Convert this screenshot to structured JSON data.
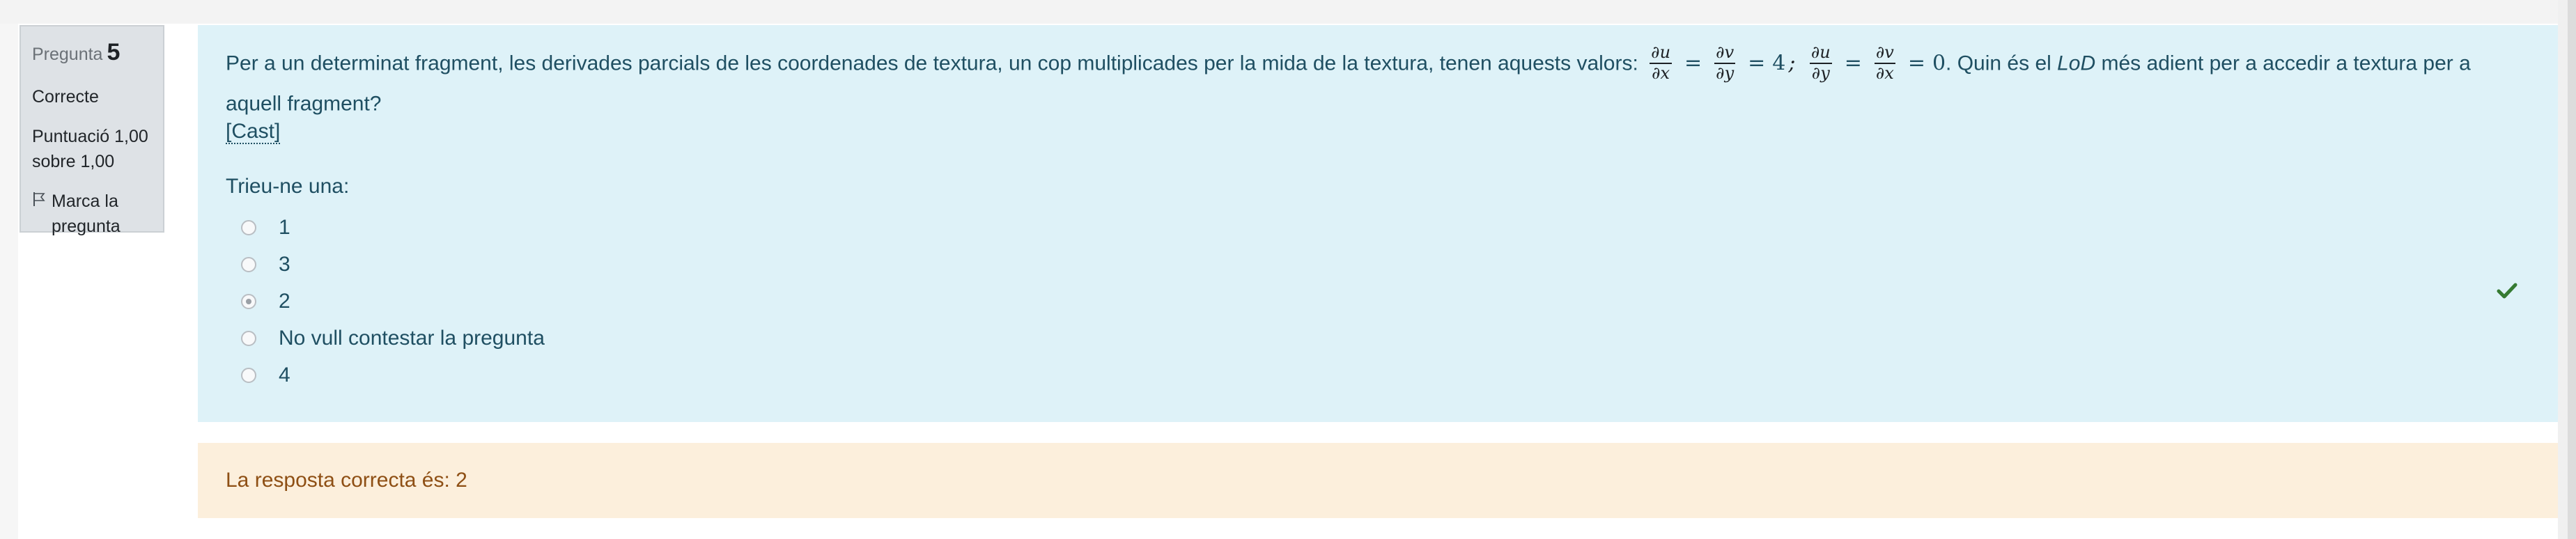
{
  "question_info": {
    "label": "Pregunta",
    "number": "5",
    "state": "Correcte",
    "grade": "Puntuació 1,00 sobre 1,00",
    "flag": "Marca la pregunta"
  },
  "question": {
    "text_before": "Per a un determinat fragment, les derivades parcials de les coordenades de textura, un cop multiplicades per la mida de la textura, tenen aquests valors:",
    "math": {
      "du": "∂u",
      "dv": "∂v",
      "dx": "∂x",
      "dy": "∂y",
      "eq": "=",
      "four": "4",
      "zero": "0",
      "sep": ";"
    },
    "text_mid": ". Quin és el ",
    "lod": "LoD",
    "text_after": " més adient per a accedir a textura per a aquell fragment?",
    "cast_link": "[Cast]"
  },
  "prompt": "Trieu-ne una:",
  "answers": [
    {
      "label": "1",
      "selected": false
    },
    {
      "label": "3",
      "selected": false
    },
    {
      "label": "2",
      "selected": true
    },
    {
      "label": "No vull contestar la pregunta",
      "selected": false
    },
    {
      "label": "4",
      "selected": false
    }
  ],
  "feedback": {
    "right_answer": "La resposta correcta és: 2"
  },
  "colors": {
    "formulation_bg": "#def2f8",
    "outcome_bg": "#fcefdc",
    "info_bg": "#dee2e6",
    "correct_check": "#357a32"
  }
}
